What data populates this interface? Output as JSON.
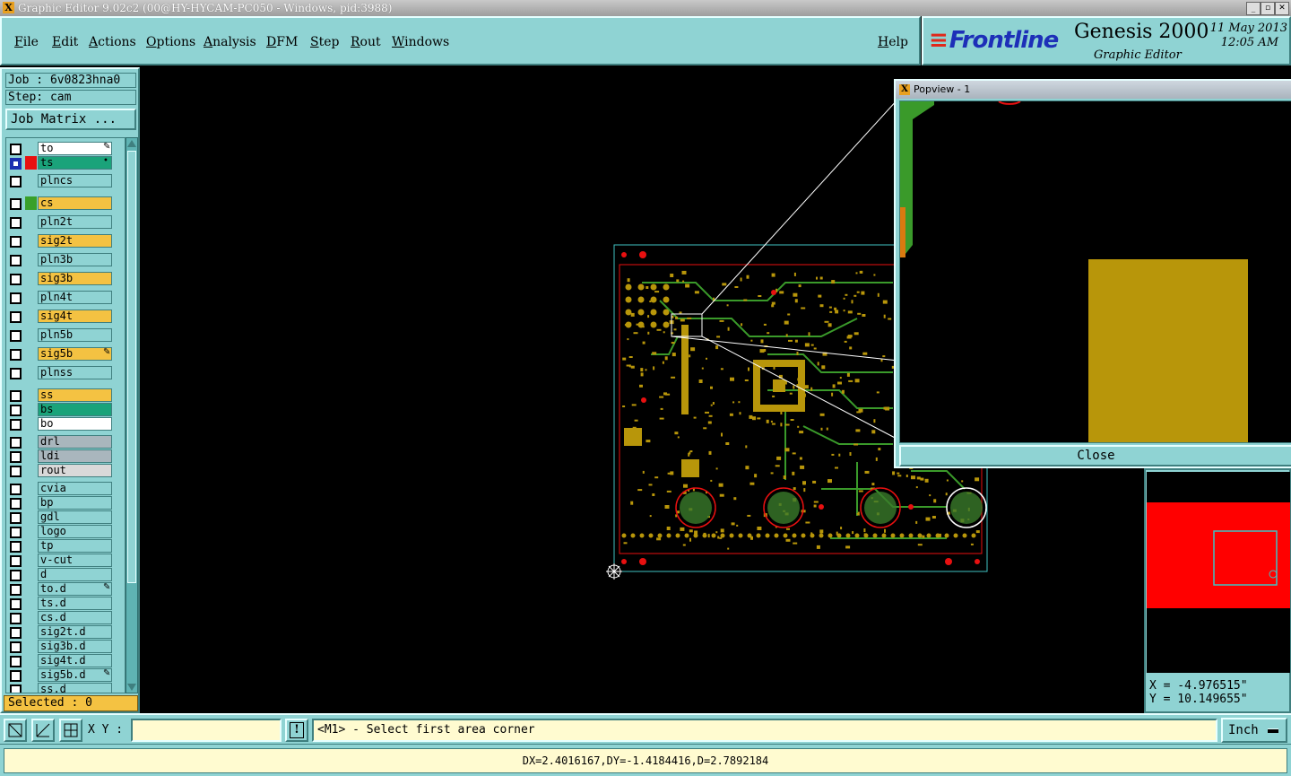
{
  "window": {
    "title": "Graphic Editor 9.02c2 (00@HY-HYCAM-PC050 - Windows, pid:3988)"
  },
  "menu": {
    "items": [
      "File",
      "Edit",
      "Actions",
      "Options",
      "Analysis",
      "DFM",
      "Step",
      "Rout",
      "Windows"
    ],
    "help": "Help"
  },
  "brand": {
    "logo": "Frontline",
    "product": "Genesis 2000",
    "subtitle": "Graphic Editor",
    "date": "11 May 2013",
    "time": "12:05 AM"
  },
  "job": {
    "job_label": "Job : 6v0823hna0",
    "step_label": "Step: cam",
    "matrix_button": "Job Matrix ..."
  },
  "layers": [
    {
      "name": "to",
      "color": "#ffffff",
      "swatch": "",
      "marker": "pen"
    },
    {
      "name": "ts",
      "color": "#1aa37a",
      "swatch": "#e81010",
      "marker": "dot",
      "selected": true
    },
    {
      "name": "plncs",
      "color": "#8fd3d3",
      "swatch": ""
    },
    {
      "name": "cs",
      "color": "#f4c242",
      "swatch": "#39a02a"
    },
    {
      "name": "pln2t",
      "color": "#8fd3d3",
      "swatch": ""
    },
    {
      "name": "sig2t",
      "color": "#f4c242",
      "swatch": ""
    },
    {
      "name": "pln3b",
      "color": "#8fd3d3",
      "swatch": ""
    },
    {
      "name": "sig3b",
      "color": "#f4c242",
      "swatch": ""
    },
    {
      "name": "pln4t",
      "color": "#8fd3d3",
      "swatch": ""
    },
    {
      "name": "sig4t",
      "color": "#f4c242",
      "swatch": ""
    },
    {
      "name": "pln5b",
      "color": "#8fd3d3",
      "swatch": ""
    },
    {
      "name": "sig5b",
      "color": "#f4c242",
      "swatch": "",
      "marker": "pen"
    },
    {
      "name": "plnss",
      "color": "#8fd3d3",
      "swatch": ""
    },
    {
      "name": "ss",
      "color": "#f4c242",
      "swatch": ""
    },
    {
      "name": "bs",
      "color": "#1aa37a",
      "swatch": ""
    },
    {
      "name": "bo",
      "color": "#ffffff",
      "swatch": ""
    },
    {
      "name": "drl",
      "color": "#a9b6bd",
      "swatch": ""
    },
    {
      "name": "ldi",
      "color": "#a9b6bd",
      "swatch": ""
    },
    {
      "name": "rout",
      "color": "#d9d9d9",
      "swatch": ""
    },
    {
      "name": "cvia",
      "color": "#8fd3d3",
      "swatch": ""
    },
    {
      "name": "bp",
      "color": "#8fd3d3",
      "swatch": ""
    },
    {
      "name": "gdl",
      "color": "#8fd3d3",
      "swatch": ""
    },
    {
      "name": "logo",
      "color": "#8fd3d3",
      "swatch": ""
    },
    {
      "name": "tp",
      "color": "#8fd3d3",
      "swatch": ""
    },
    {
      "name": "v-cut",
      "color": "#8fd3d3",
      "swatch": ""
    },
    {
      "name": "d",
      "color": "#8fd3d3",
      "swatch": ""
    },
    {
      "name": "to.d",
      "color": "#8fd3d3",
      "swatch": "",
      "marker": "pen"
    },
    {
      "name": "ts.d",
      "color": "#8fd3d3",
      "swatch": ""
    },
    {
      "name": "cs.d",
      "color": "#8fd3d3",
      "swatch": ""
    },
    {
      "name": "sig2t.d",
      "color": "#8fd3d3",
      "swatch": ""
    },
    {
      "name": "sig3b.d",
      "color": "#8fd3d3",
      "swatch": ""
    },
    {
      "name": "sig4t.d",
      "color": "#8fd3d3",
      "swatch": ""
    },
    {
      "name": "sig5b.d",
      "color": "#8fd3d3",
      "swatch": "",
      "marker": "pen"
    },
    {
      "name": "ss.d",
      "color": "#8fd3d3",
      "swatch": ""
    }
  ],
  "selected_label": "Selected : 0",
  "popview": {
    "title": "Popview - 1",
    "close_label": "Close"
  },
  "coords": {
    "x_label": "X = -4.976515\"",
    "y_label": "Y = 10.149655\""
  },
  "bottom": {
    "xy_label": "X Y :",
    "xy_value": "",
    "info_symbol": "!",
    "prompt": "<M1> - Select first area corner",
    "units": "Inch"
  },
  "status": {
    "text": "DX=2.4016167,DY=-1.4184416,D=2.7892184"
  },
  "colors": {
    "panel": "#8fd3d3",
    "layer_signal": "#f4c242",
    "layer_ts": "#1aa37a",
    "pcb_copper": "#b8960a",
    "pcb_trace": "#3a9a2a",
    "pcb_outline": "#e81010"
  },
  "icons": {
    "toolbar": [
      "zoom-area-icon",
      "measure-icon",
      "snap-grid-icon"
    ]
  }
}
